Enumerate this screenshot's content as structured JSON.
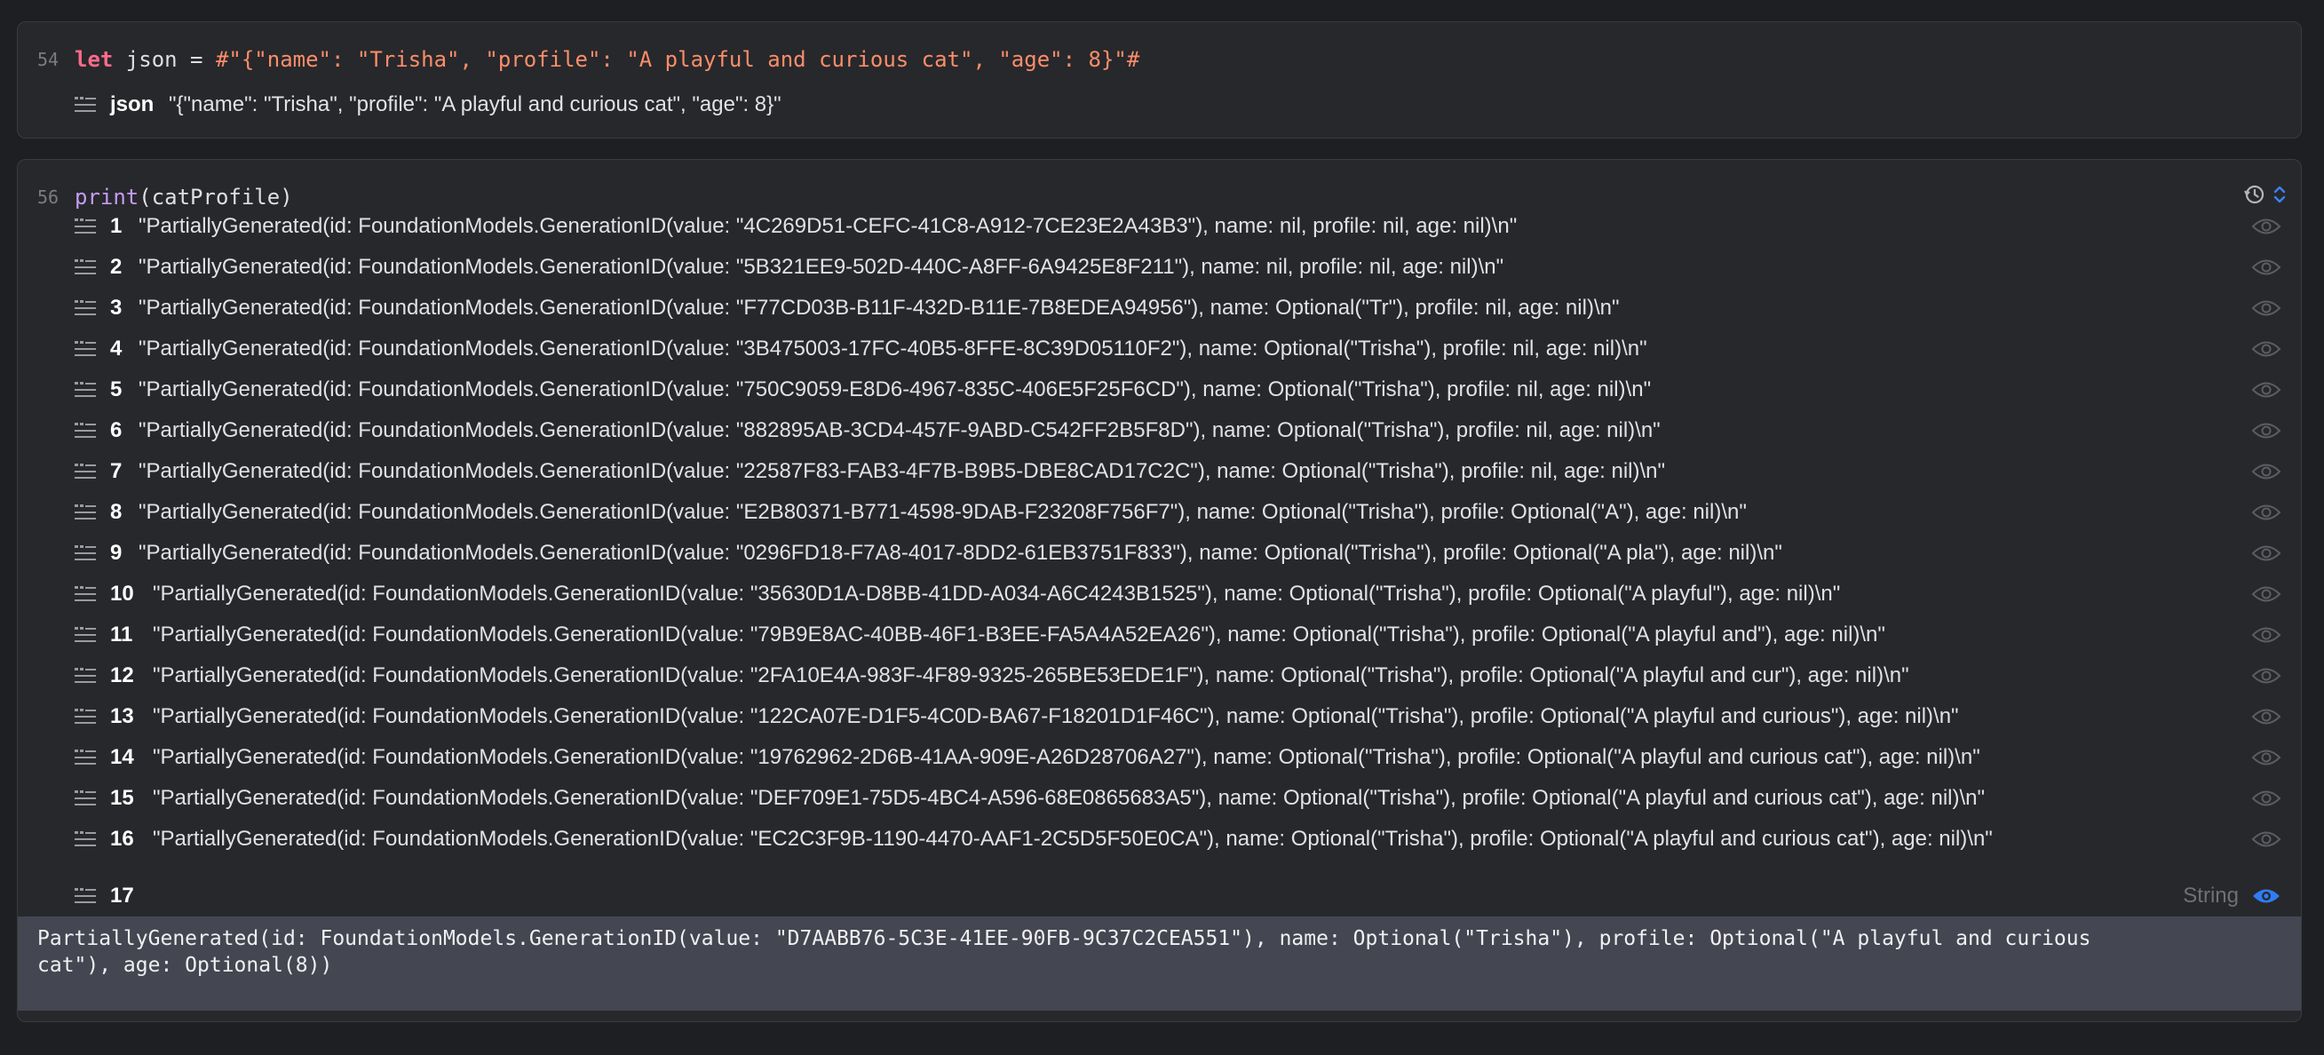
{
  "cell1": {
    "line_number": "54",
    "code": {
      "keyword": "let",
      "name": " json = ",
      "string": "#\"{\"name\": \"Trisha\", \"profile\": \"A playful and curious cat\", \"age\": 8}\"#"
    },
    "result": {
      "label": "json",
      "value": "\"{\"name\": \"Trisha\", \"profile\": \"A playful and curious cat\", \"age\": 8}\""
    }
  },
  "cell2": {
    "line_number": "56",
    "code": {
      "function": "print",
      "args": "(catProfile)"
    },
    "results": [
      {
        "n": "1",
        "text": "\"PartiallyGenerated(id: FoundationModels.GenerationID(value: \"4C269D51-CEFC-41C8-A912-7CE23E2A43B3\"), name: nil, profile: nil, age: nil)\\n\""
      },
      {
        "n": "2",
        "text": "\"PartiallyGenerated(id: FoundationModels.GenerationID(value: \"5B321EE9-502D-440C-A8FF-6A9425E8F211\"), name: nil, profile: nil, age: nil)\\n\""
      },
      {
        "n": "3",
        "text": "\"PartiallyGenerated(id: FoundationModels.GenerationID(value: \"F77CD03B-B11F-432D-B11E-7B8EDEA94956\"), name: Optional(\"Tr\"), profile: nil, age: nil)\\n\""
      },
      {
        "n": "4",
        "text": "\"PartiallyGenerated(id: FoundationModels.GenerationID(value: \"3B475003-17FC-40B5-8FFE-8C39D05110F2\"), name: Optional(\"Trisha\"), profile: nil, age: nil)\\n\""
      },
      {
        "n": "5",
        "text": "\"PartiallyGenerated(id: FoundationModels.GenerationID(value: \"750C9059-E8D6-4967-835C-406E5F25F6CD\"), name: Optional(\"Trisha\"), profile: nil, age: nil)\\n\""
      },
      {
        "n": "6",
        "text": "\"PartiallyGenerated(id: FoundationModels.GenerationID(value: \"882895AB-3CD4-457F-9ABD-C542FF2B5F8D\"), name: Optional(\"Trisha\"), profile: nil, age: nil)\\n\""
      },
      {
        "n": "7",
        "text": "\"PartiallyGenerated(id: FoundationModels.GenerationID(value: \"22587F83-FAB3-4F7B-B9B5-DBE8CAD17C2C\"), name: Optional(\"Trisha\"), profile: nil, age: nil)\\n\""
      },
      {
        "n": "8",
        "text": "\"PartiallyGenerated(id: FoundationModels.GenerationID(value: \"E2B80371-B771-4598-9DAB-F23208F756F7\"), name: Optional(\"Trisha\"), profile: Optional(\"A\"), age: nil)\\n\""
      },
      {
        "n": "9",
        "text": "\"PartiallyGenerated(id: FoundationModels.GenerationID(value: \"0296FD18-F7A8-4017-8DD2-61EB3751F833\"), name: Optional(\"Trisha\"), profile: Optional(\"A pla\"), age: nil)\\n\""
      },
      {
        "n": "10",
        "text": "\"PartiallyGenerated(id: FoundationModels.GenerationID(value: \"35630D1A-D8BB-41DD-A034-A6C4243B1525\"), name: Optional(\"Trisha\"), profile: Optional(\"A playful\"), age: nil)\\n\""
      },
      {
        "n": "11",
        "text": "\"PartiallyGenerated(id: FoundationModels.GenerationID(value: \"79B9E8AC-40BB-46F1-B3EE-FA5A4A52EA26\"), name: Optional(\"Trisha\"), profile: Optional(\"A playful and\"), age: nil)\\n\""
      },
      {
        "n": "12",
        "text": "\"PartiallyGenerated(id: FoundationModels.GenerationID(value: \"2FA10E4A-983F-4F89-9325-265BE53EDE1F\"), name: Optional(\"Trisha\"), profile: Optional(\"A playful and cur\"), age: nil)\\n\""
      },
      {
        "n": "13",
        "text": "\"PartiallyGenerated(id: FoundationModels.GenerationID(value: \"122CA07E-D1F5-4C0D-BA67-F18201D1F46C\"), name: Optional(\"Trisha\"), profile: Optional(\"A playful and curious\"), age: nil)\\n\""
      },
      {
        "n": "14",
        "text": "\"PartiallyGenerated(id: FoundationModels.GenerationID(value: \"19762962-2D6B-41AA-909E-A26D28706A27\"), name: Optional(\"Trisha\"), profile: Optional(\"A playful and curious cat\"), age: nil)\\n\""
      },
      {
        "n": "15",
        "text": "\"PartiallyGenerated(id: FoundationModels.GenerationID(value: \"DEF709E1-75D5-4BC4-A596-68E0865683A5\"), name: Optional(\"Trisha\"), profile: Optional(\"A playful and curious cat\"), age: nil)\\n\""
      },
      {
        "n": "16",
        "text": "\"PartiallyGenerated(id: FoundationModels.GenerationID(value: \"EC2C3F9B-1190-4470-AAF1-2C5D5F50E0CA\"), name: Optional(\"Trisha\"), profile: Optional(\"A playful and curious cat\"), age: nil)\\n\""
      }
    ],
    "selected_row": {
      "n": "17",
      "type": "String"
    },
    "detail": "PartiallyGenerated(id: FoundationModels.GenerationID(value: \"D7AABB76-5C3E-41EE-90FB-9C37C2CEA551\"), name: Optional(\"Trisha\"), profile: Optional(\"A playful and curious\ncat\"), age: Optional(8))"
  },
  "icons": {
    "result_list": "list-result-icon",
    "eye": "eye-icon",
    "history": "history-icon",
    "stepper": "chevron-updown-icon"
  },
  "colors": {
    "keyword": "#fc6a8c",
    "string": "#fc8d6a",
    "function": "#c59bf7",
    "accent": "#2f7cf6"
  }
}
